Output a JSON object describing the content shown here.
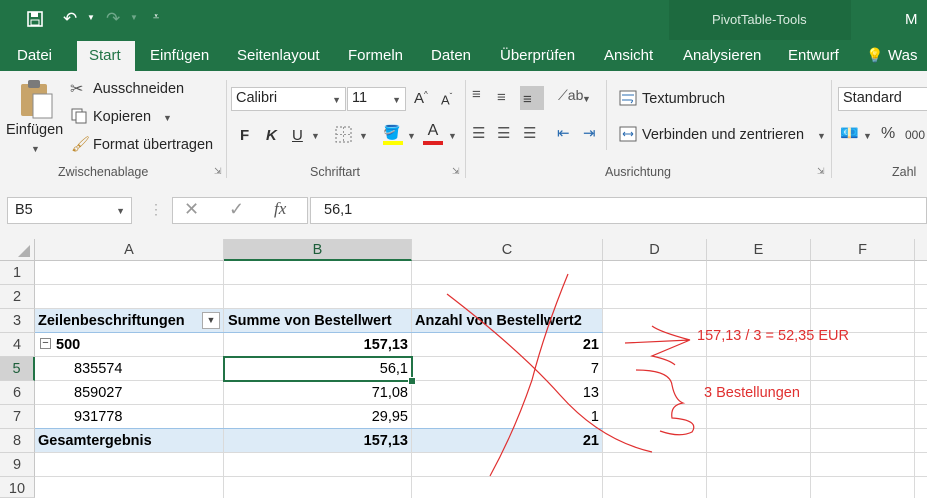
{
  "titlebar": {
    "tools_label": "PivotTable-Tools",
    "title_partial": "M"
  },
  "tabs": [
    {
      "label": "Datei"
    },
    {
      "label": "Start"
    },
    {
      "label": "Einfügen"
    },
    {
      "label": "Seitenlayout"
    },
    {
      "label": "Formeln"
    },
    {
      "label": "Daten"
    },
    {
      "label": "Überprüfen"
    },
    {
      "label": "Ansicht"
    },
    {
      "label": "Analysieren"
    },
    {
      "label": "Entwurf"
    },
    {
      "label": "Was"
    }
  ],
  "ribbon": {
    "clipboard": {
      "paste": "Einfügen",
      "cut": "Ausschneiden",
      "copy": "Kopieren",
      "format_painter": "Format übertragen",
      "group": "Zwischenablage"
    },
    "font": {
      "name": "Calibri",
      "size": "11",
      "bold": "F",
      "italic": "K",
      "underline": "U",
      "group": "Schriftart"
    },
    "alignment": {
      "wrap": "Textumbruch",
      "merge": "Verbinden und zentrieren",
      "group": "Ausrichtung"
    },
    "number": {
      "format": "Standard",
      "group": "Zahl"
    }
  },
  "formula_bar": {
    "name_box": "B5",
    "formula": "56,1"
  },
  "columns": [
    "A",
    "B",
    "C",
    "D",
    "E",
    "F"
  ],
  "rows": [
    "1",
    "2",
    "3",
    "4",
    "5",
    "6",
    "7",
    "8",
    "9",
    "10"
  ],
  "pivot": {
    "header": {
      "a": "Zeilenbeschriftungen",
      "b": "Summe von Bestellwert",
      "c": "Anzahl von Bestellwert2"
    },
    "group": {
      "a": "500",
      "b": "157,13",
      "c": "21"
    },
    "items": [
      {
        "a": "835574",
        "b": "56,1",
        "c": "7"
      },
      {
        "a": "859027",
        "b": "71,08",
        "c": "13"
      },
      {
        "a": "931778",
        "b": "29,95",
        "c": "1"
      }
    ],
    "total": {
      "a": "Gesamtergebnis",
      "b": "157,13",
      "c": "21"
    }
  },
  "annotations": {
    "calc": "157,13 / 3 = 52,35 EUR",
    "orders": "3 Bestellungen"
  },
  "colors": {
    "excel_green": "#217346",
    "pivot_blue": "#ddebf7",
    "ink_red": "#e03030"
  }
}
